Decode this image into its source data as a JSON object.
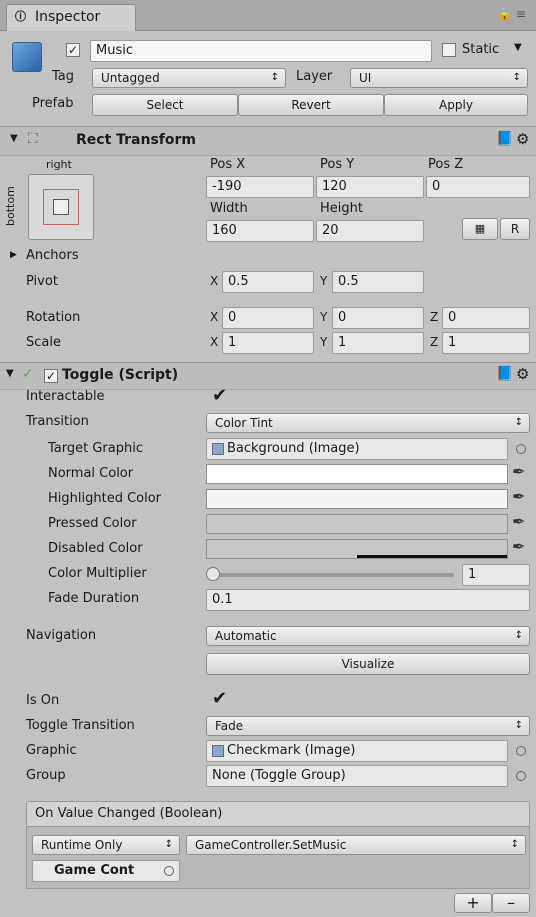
{
  "tab": {
    "title": "Inspector",
    "icon": "info-icon"
  },
  "gameobject": {
    "name": "Music",
    "active": true,
    "static_label": "Static",
    "tag_label": "Tag",
    "tag_value": "Untagged",
    "layer_label": "Layer",
    "layer_value": "UI",
    "prefab_label": "Prefab",
    "prefab_buttons": [
      "Select",
      "Revert",
      "Apply"
    ]
  },
  "rect_transform": {
    "title": "Rect Transform",
    "anchor_h": "right",
    "anchor_v": "bottom",
    "headers": [
      "Pos X",
      "Pos Y",
      "Pos Z"
    ],
    "pos": [
      "-190",
      "120",
      "0"
    ],
    "width_label": "Width",
    "height_label": "Height",
    "width": "160",
    "height": "20",
    "r_button": "R",
    "anchors_label": "Anchors",
    "pivot_label": "Pivot",
    "pivot": {
      "x": "0.5",
      "y": "0.5"
    },
    "rotation_label": "Rotation",
    "rotation": {
      "x": "0",
      "y": "0",
      "z": "0"
    },
    "scale_label": "Scale",
    "scale": {
      "x": "1",
      "y": "1",
      "z": "1"
    },
    "axis": {
      "x": "X",
      "y": "Y",
      "z": "Z"
    }
  },
  "toggle": {
    "title": "Toggle (Script)",
    "interactable_label": "Interactable",
    "transition_label": "Transition",
    "transition_value": "Color Tint",
    "target_graphic_label": "Target Graphic",
    "target_graphic_value": "Background (Image)",
    "normal_color_label": "Normal Color",
    "highlighted_color_label": "Highlighted Color",
    "pressed_color_label": "Pressed Color",
    "disabled_color_label": "Disabled Color",
    "color_multiplier_label": "Color Multiplier",
    "color_multiplier_value": "1",
    "color_multiplier_slider_fraction": 0.0,
    "fade_duration_label": "Fade Duration",
    "fade_duration_value": "0.1",
    "navigation_label": "Navigation",
    "navigation_value": "Automatic",
    "visualize_label": "Visualize",
    "is_on_label": "Is On",
    "toggle_transition_label": "Toggle Transition",
    "toggle_transition_value": "Fade",
    "graphic_label": "Graphic",
    "graphic_value": "Checkmark (Image)",
    "group_label": "Group",
    "group_value": "None (Toggle Group)",
    "event_title": "On Value Changed (Boolean)",
    "event_runtime": "Runtime Only",
    "event_function": "GameController.SetMusic",
    "event_object": "Game Cont",
    "add_label": "+",
    "remove_label": "–"
  },
  "colors": {
    "normal": "#ffffff",
    "highlighted": "#f5f5f5",
    "pressed": "#c8c8c8",
    "disabled": "#c8c8c8"
  }
}
